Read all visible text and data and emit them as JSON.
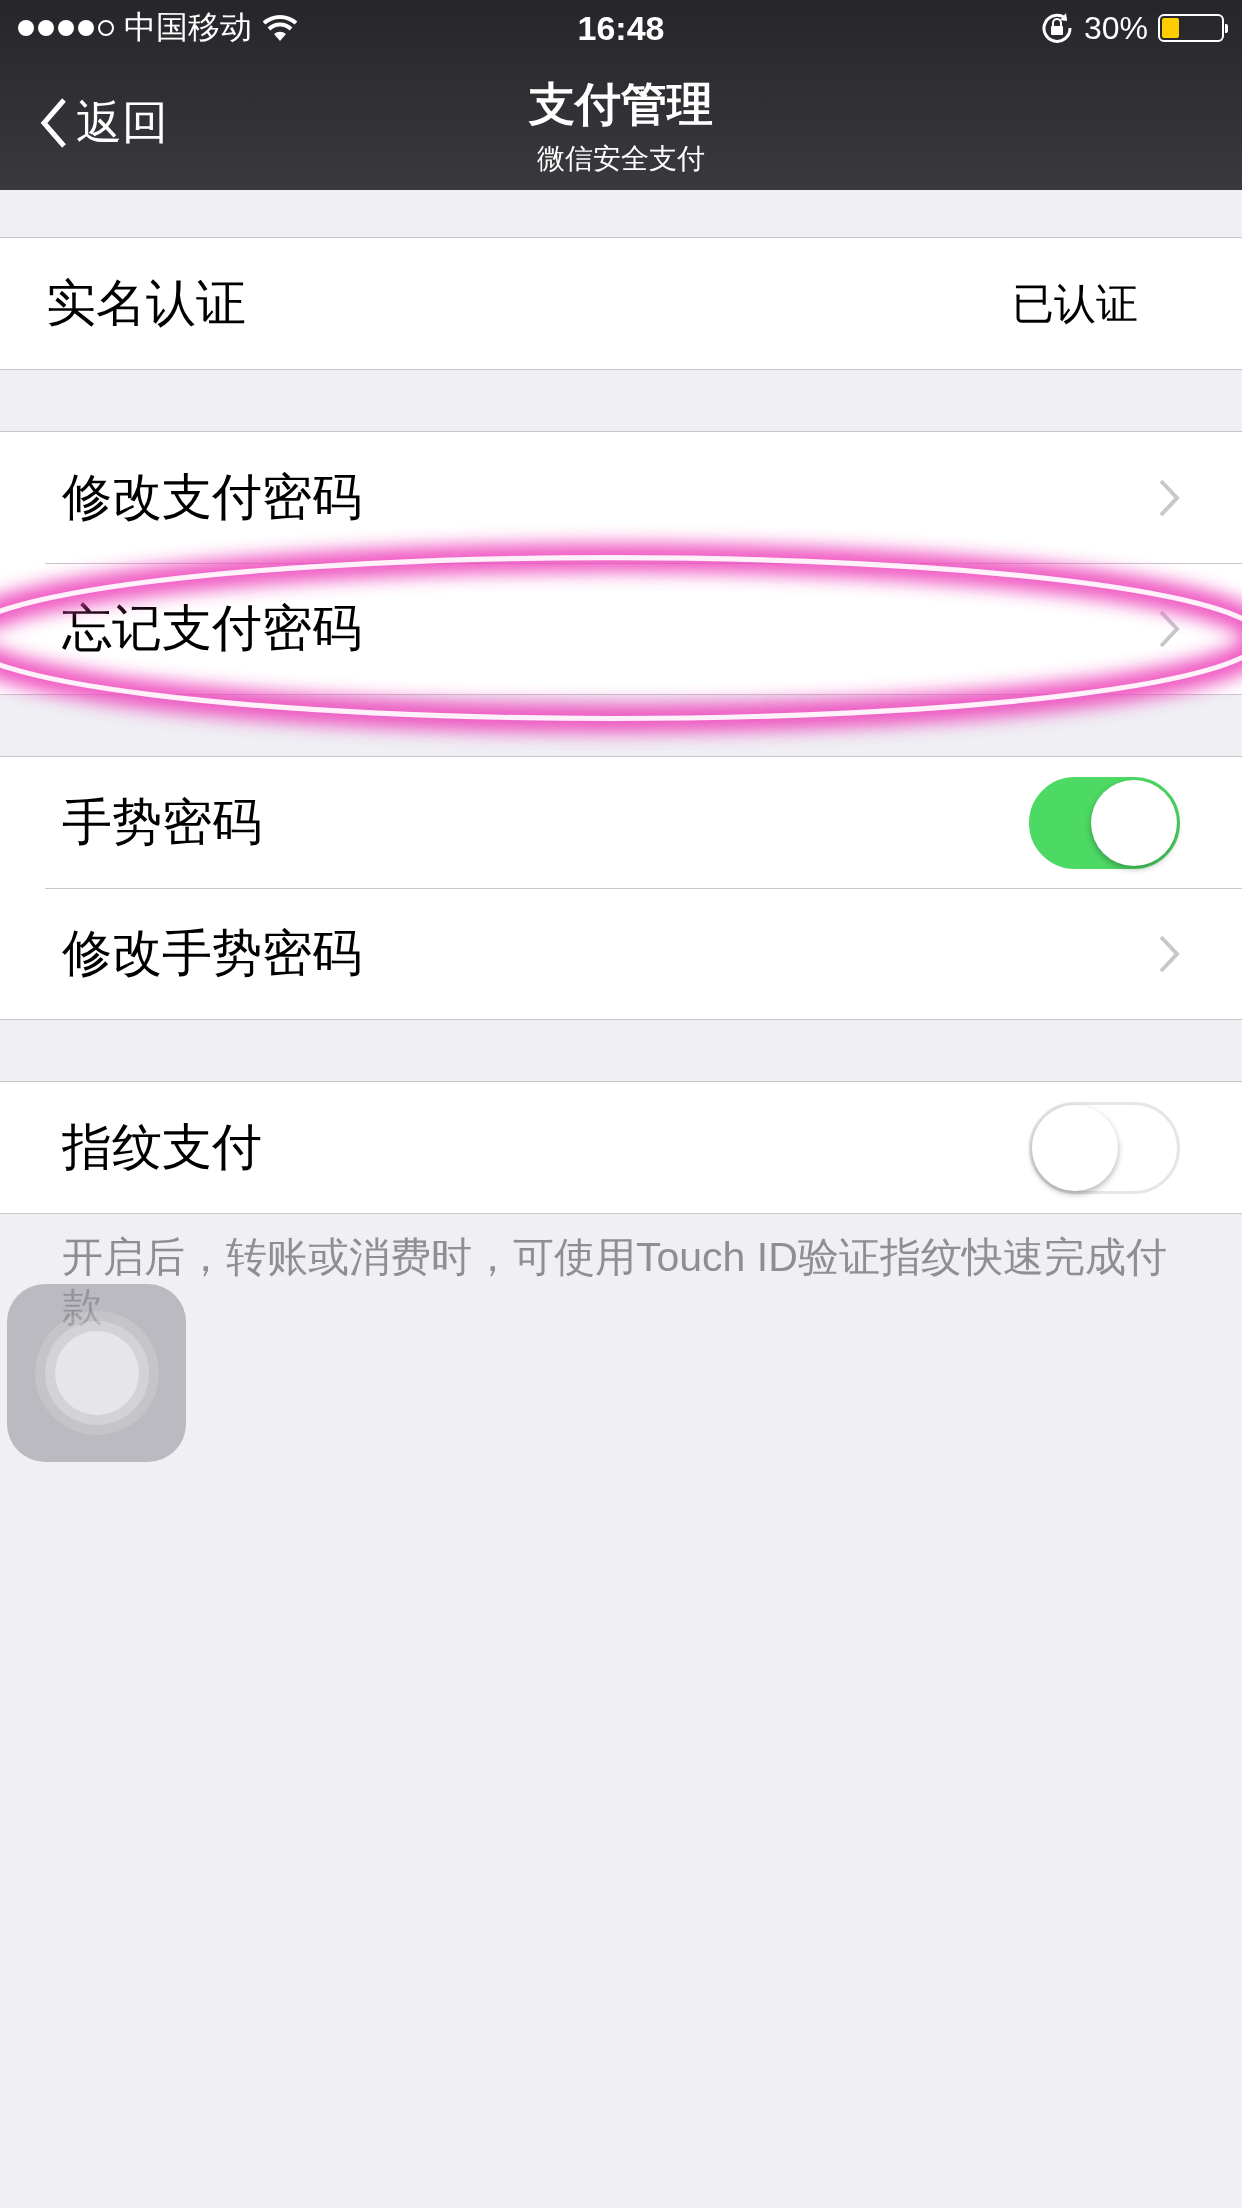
{
  "status_bar": {
    "carrier": "中国移动",
    "time": "16:48",
    "battery": "30%"
  },
  "nav": {
    "back": "返回",
    "title": "支付管理",
    "subtitle": "微信安全支付"
  },
  "sections": [
    {
      "rows": [
        {
          "kind": "value",
          "label": "实名认证",
          "value": "已认证"
        }
      ]
    },
    {
      "rows": [
        {
          "kind": "link",
          "label": "修改支付密码",
          "circled": false
        },
        {
          "kind": "link",
          "label": "忘记支付密码",
          "circled": true
        }
      ]
    },
    {
      "rows": [
        {
          "kind": "toggle",
          "label": "手势密码",
          "on": true
        },
        {
          "kind": "link",
          "label": "修改手势密码",
          "circled": false
        }
      ]
    },
    {
      "rows": [
        {
          "kind": "toggle",
          "label": "指纹支付",
          "on": false
        }
      ]
    }
  ],
  "footer": "开启后，转账或消费时，可使用Touch ID验证指纹快速完成付款"
}
